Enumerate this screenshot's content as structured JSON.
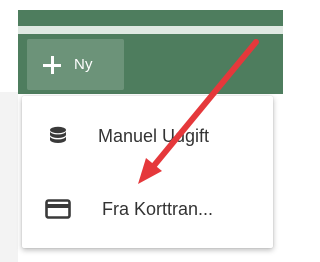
{
  "toolbar": {
    "new_button_label": "Ny",
    "new_button_icon": "plus-icon"
  },
  "menu": {
    "items": [
      {
        "label": "Manuel Udgift",
        "icon": "database-icon"
      },
      {
        "label": "Fra Korttran...",
        "icon": "credit-card-icon"
      }
    ]
  },
  "colors": {
    "toolbar_green": "#4e7d5e",
    "button_green": "#6c9379",
    "arrow_red": "#e5383b",
    "menu_text": "#333333"
  }
}
